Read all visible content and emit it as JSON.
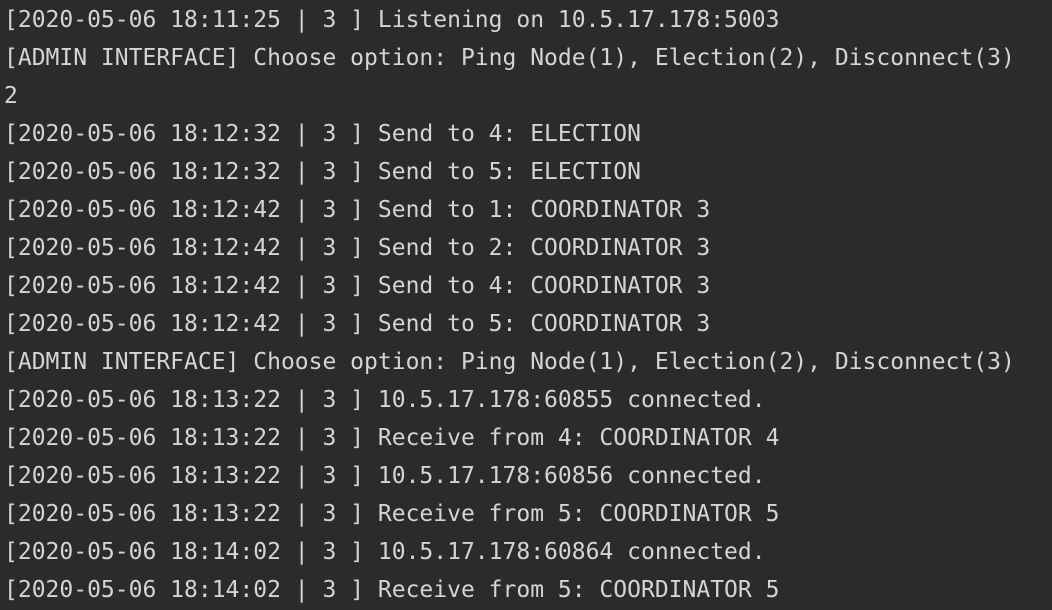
{
  "terminal": {
    "lines": [
      "[2020-05-06 18:11:25 | 3 ] Listening on 10.5.17.178:5003",
      "[ADMIN INTERFACE] Choose option: Ping Node(1), Election(2), Disconnect(3)",
      "2",
      "[2020-05-06 18:12:32 | 3 ] Send to 4: ELECTION",
      "[2020-05-06 18:12:32 | 3 ] Send to 5: ELECTION",
      "[2020-05-06 18:12:42 | 3 ] Send to 1: COORDINATOR 3",
      "[2020-05-06 18:12:42 | 3 ] Send to 2: COORDINATOR 3",
      "[2020-05-06 18:12:42 | 3 ] Send to 4: COORDINATOR 3",
      "[2020-05-06 18:12:42 | 3 ] Send to 5: COORDINATOR 3",
      "[ADMIN INTERFACE] Choose option: Ping Node(1), Election(2), Disconnect(3)",
      "[2020-05-06 18:13:22 | 3 ] 10.5.17.178:60855 connected.",
      "[2020-05-06 18:13:22 | 3 ] Receive from 4: COORDINATOR 4",
      "[2020-05-06 18:13:22 | 3 ] 10.5.17.178:60856 connected.",
      "[2020-05-06 18:13:22 | 3 ] Receive from 5: COORDINATOR 5",
      "[2020-05-06 18:14:02 | 3 ] 10.5.17.178:60864 connected.",
      "[2020-05-06 18:14:02 | 3 ] Receive from 5: COORDINATOR 5"
    ]
  },
  "colors": {
    "background": "#2b2b2b",
    "text": "#d4d4d4"
  }
}
